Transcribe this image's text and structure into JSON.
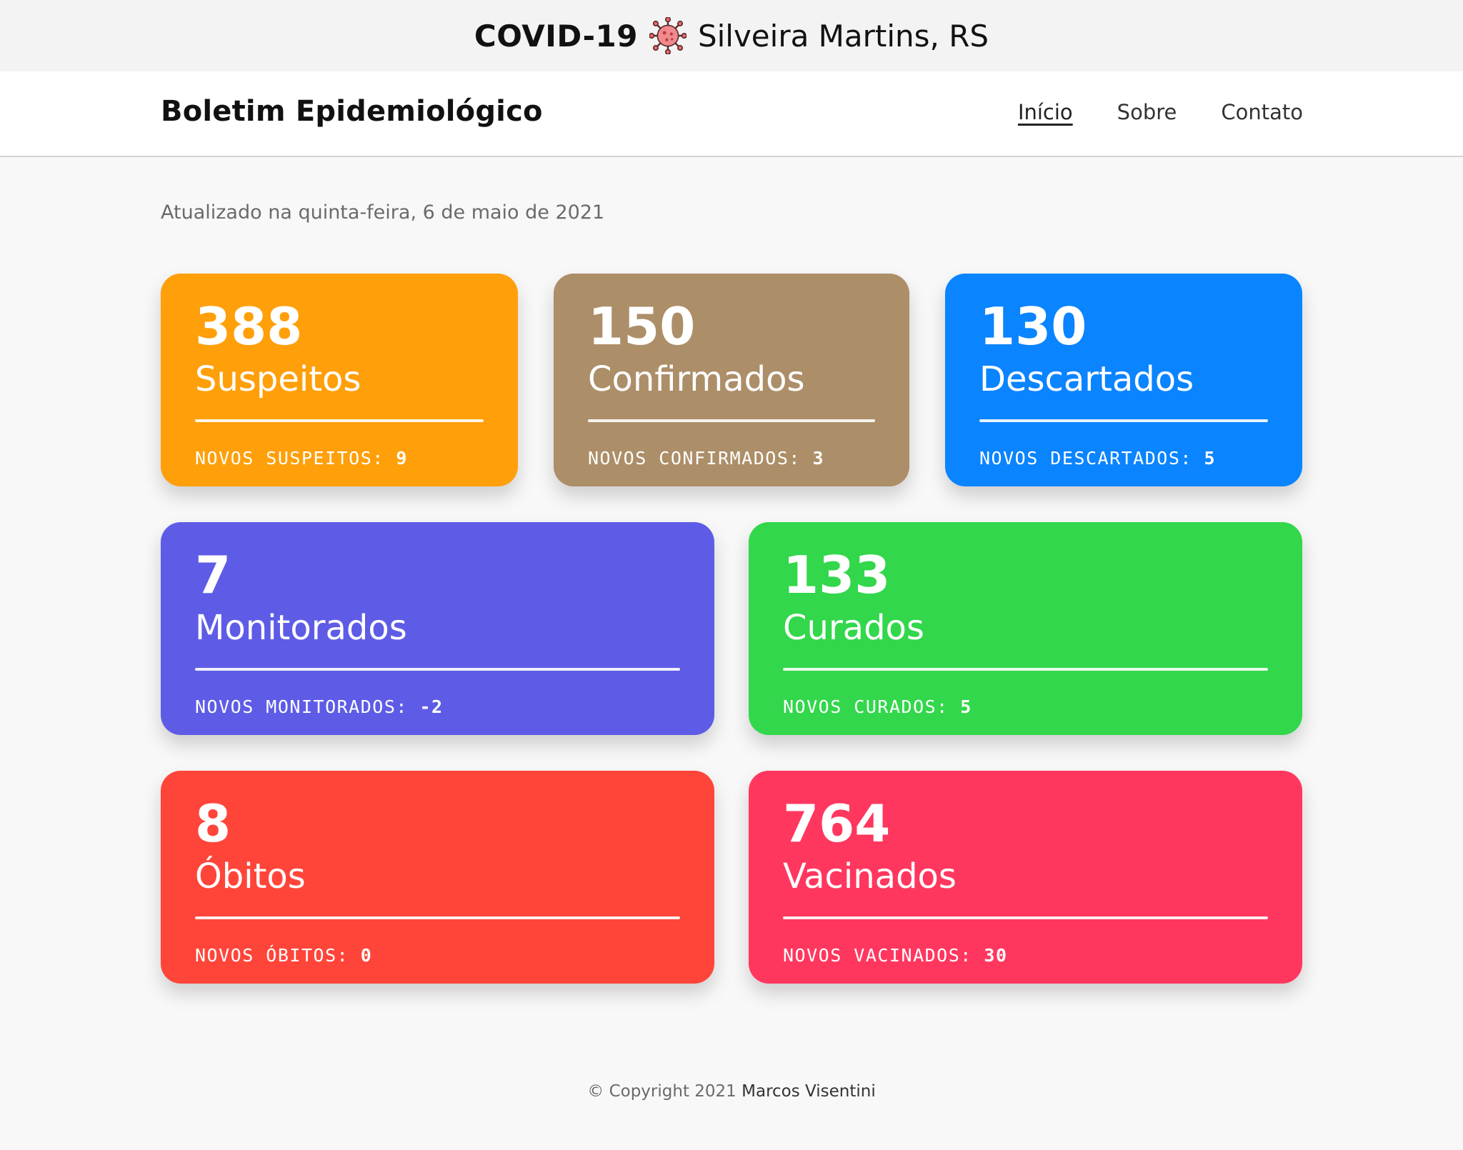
{
  "header": {
    "title_main": "COVID-19",
    "title_icon": "virus-icon",
    "title_city": "Silveira Martins, RS"
  },
  "navbar": {
    "brand": "Boletim Epidemiológico",
    "links": [
      {
        "label": "Início",
        "active": true
      },
      {
        "label": "Sobre",
        "active": false
      },
      {
        "label": "Contato",
        "active": false
      }
    ]
  },
  "updated_text": "Atualizado na quinta-feira, 6 de maio de 2021",
  "cards": [
    {
      "count": "388",
      "label": "Suspeitos",
      "new_label": "NOVOS SUSPEITOS:",
      "new_value": "9",
      "color": "#ff9f0a"
    },
    {
      "count": "150",
      "label": "Confirmados",
      "new_label": "NOVOS CONFIRMADOS:",
      "new_value": "3",
      "color": "#ac8e68"
    },
    {
      "count": "130",
      "label": "Descartados",
      "new_label": "NOVOS DESCARTADOS:",
      "new_value": "5",
      "color": "#0a84ff"
    },
    {
      "count": "7",
      "label": "Monitorados",
      "new_label": "NOVOS MONITORADOS:",
      "new_value": "-2",
      "color": "#5e5ce6"
    },
    {
      "count": "133",
      "label": "Curados",
      "new_label": "NOVOS CURADOS:",
      "new_value": "5",
      "color": "#32d74b"
    },
    {
      "count": "8",
      "label": "Óbitos",
      "new_label": "NOVOS ÓBITOS:",
      "new_value": "0",
      "color": "#ff453a"
    },
    {
      "count": "764",
      "label": "Vacinados",
      "new_label": "NOVOS VACINADOS:",
      "new_value": "30",
      "color": "#ff375f"
    }
  ],
  "footer": {
    "copyright": "© Copyright 2021",
    "author": "Marcos Visentini"
  }
}
